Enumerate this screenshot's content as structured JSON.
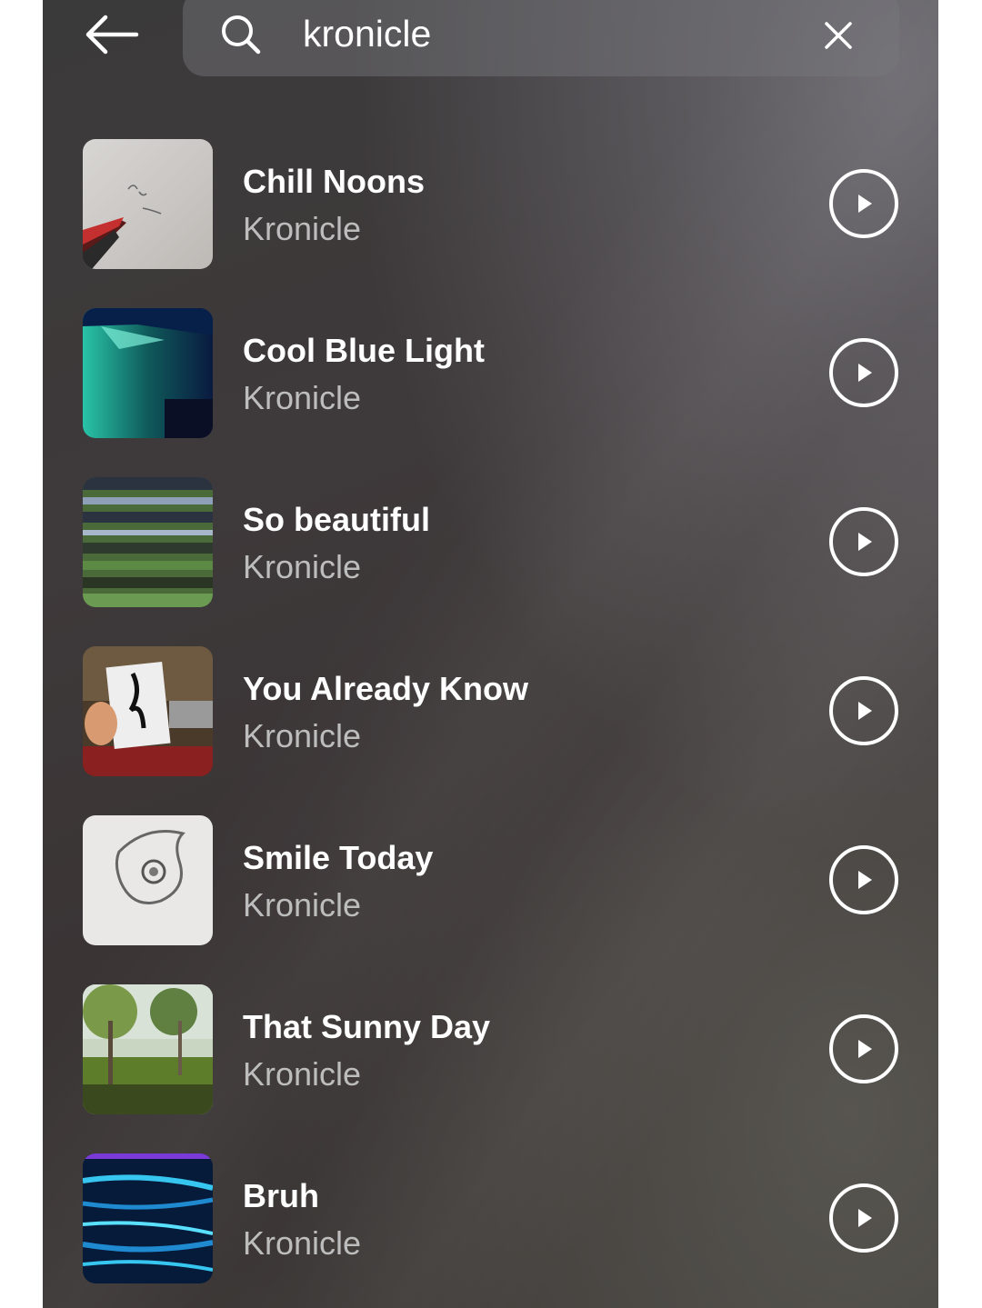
{
  "header": {
    "back_icon": "arrow-left-icon",
    "search_icon": "search-icon",
    "query": "kronicle",
    "clear_icon": "close-icon"
  },
  "results": [
    {
      "title": "Chill Noons",
      "artist": "Kronicle",
      "art": "paper-sketch"
    },
    {
      "title": "Cool Blue Light",
      "artist": "Kronicle",
      "art": "teal-light"
    },
    {
      "title": "So beautiful",
      "artist": "Kronicle",
      "art": "blinds-trees"
    },
    {
      "title": "You Already Know",
      "artist": "Kronicle",
      "art": "drawing-hand"
    },
    {
      "title": "Smile Today",
      "artist": "Kronicle",
      "art": "tribal-drawing"
    },
    {
      "title": "That Sunny Day",
      "artist": "Kronicle",
      "art": "park-trees"
    },
    {
      "title": "Bruh",
      "artist": "Kronicle",
      "art": "light-streaks"
    }
  ],
  "colors": {
    "title": "#ffffff",
    "artist": "#bdbdbd",
    "play_ring": "#ffffff"
  }
}
